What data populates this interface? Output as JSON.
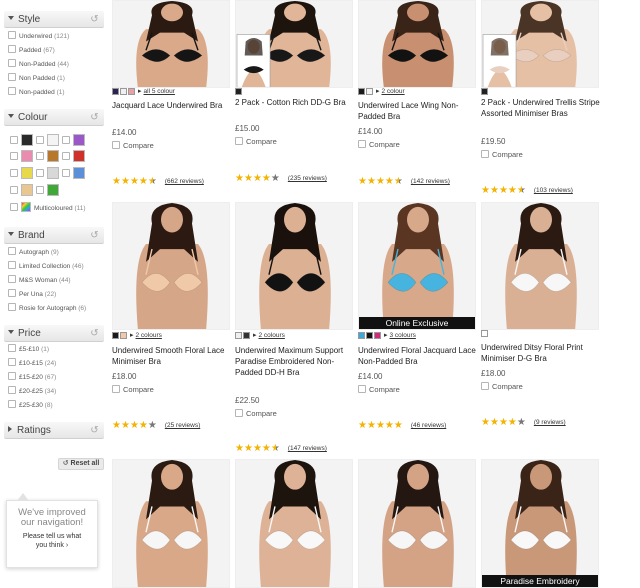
{
  "filters": {
    "style": {
      "title": "Style",
      "options": [
        {
          "label": "Underwired",
          "count": "(121)"
        },
        {
          "label": "Padded",
          "count": "(67)"
        },
        {
          "label": "Non-Padded",
          "count": "(44)"
        },
        {
          "label": "Non Padded",
          "count": "(1)"
        },
        {
          "label": "Non-padded",
          "count": "(1)"
        }
      ]
    },
    "colour": {
      "title": "Colour",
      "swatches": [
        "#2a2a2a",
        "#f4f4f4",
        "#9a58c8",
        "#e98cb0",
        "#b8782a",
        "#d0312b",
        "#e8d94a",
        "#d8d8d8",
        "#5b8fd8",
        "#e8c890",
        "#3fa838"
      ],
      "multicoloured": {
        "label": "Multicoloured",
        "count": "(11)"
      }
    },
    "brand": {
      "title": "Brand",
      "options": [
        {
          "label": "Autograph",
          "count": "(9)"
        },
        {
          "label": "Limited Collection",
          "count": "(46)"
        },
        {
          "label": "M&S Woman",
          "count": "(44)"
        },
        {
          "label": "Per Una",
          "count": "(22)"
        },
        {
          "label": "Rosie for Autograph",
          "count": "(6)"
        }
      ]
    },
    "price": {
      "title": "Price",
      "options": [
        {
          "label": "£5-£10",
          "count": "(1)"
        },
        {
          "label": "£10-£15",
          "count": "(24)"
        },
        {
          "label": "£15-£20",
          "count": "(67)"
        },
        {
          "label": "£20-£25",
          "count": "(34)"
        },
        {
          "label": "£25-£30",
          "count": "(8)"
        }
      ]
    },
    "ratings": {
      "title": "Ratings"
    },
    "reset_label": "Reset all"
  },
  "feedback": {
    "line1": "We've improved",
    "line2": "our navigation!",
    "line3": "Please tell us what",
    "line4": "you think",
    "arrow": "›"
  },
  "compare_label": "Compare",
  "products": [
    {
      "title": "Jacquard Lace Underwired Bra",
      "price": "£14.00",
      "rating": 4.5,
      "reviews": "(662 reviews)",
      "thumbs": [
        "#2a2250",
        "#f0f0f0",
        "#e8a0a8"
      ],
      "colours": "all 5 colour",
      "skin": "#d9a98a",
      "hair": "#2a1a12",
      "bra": "#151515",
      "inset": false,
      "banner": ""
    },
    {
      "title": "2 Pack - Cotton Rich DD-G Bra",
      "price": "£15.00",
      "rating": 4,
      "reviews": "(235 reviews)",
      "thumbs": [
        "#222222"
      ],
      "colours": "",
      "skin": "#e0b598",
      "hair": "#1e140e",
      "bra": "#181818",
      "inset": true,
      "banner": ""
    },
    {
      "title": "Underwired Lace Wing Non-Padded Bra",
      "price": "£14.00",
      "rating": 4.5,
      "reviews": "(142 reviews)",
      "thumbs": [
        "#1a1a1a",
        "#f5f5f5"
      ],
      "colours": "2 colour",
      "skin": "#c89070",
      "hair": "#3a2418",
      "bra": "#121212",
      "inset": false,
      "banner": ""
    },
    {
      "title": "2 Pack - Underwired Trellis Stripe Assorted Minimiser Bras",
      "price": "£19.50",
      "rating": 4.5,
      "reviews": "(103 reviews)",
      "thumbs": [
        "#222222"
      ],
      "colours": "",
      "skin": "#e6c0a4",
      "hair": "#4a3426",
      "bra": "#e8cfc0",
      "inset": true,
      "banner": ""
    },
    {
      "title": "Underwired Smooth Floral Lace Minimiser Bra",
      "price": "£18.00",
      "rating": 4,
      "reviews": "(25 reviews)",
      "thumbs": [
        "#1a1a1a",
        "#f3c8a8"
      ],
      "colours": "2 colours",
      "skin": "#d6a688",
      "hair": "#2c1a12",
      "bra": "#efc9a8",
      "inset": false,
      "banner": ""
    },
    {
      "title": "Underwired Maximum Support Paradise Embroidered Non-Padded DD-H Bra",
      "price": "£22.50",
      "rating": 4.5,
      "reviews": "(147 reviews)",
      "thumbs": [
        "#f0f0f0",
        "#333333"
      ],
      "colours": "2 colours",
      "skin": "#dcb093",
      "hair": "#1a110c",
      "bra": "#121212",
      "inset": false,
      "banner": ""
    },
    {
      "title": "Underwired Floral Jacquard Lace Non-Padded Bra",
      "price": "£14.00",
      "rating": 5,
      "reviews": "(46 reviews)",
      "thumbs": [
        "#3aa8d8",
        "#111111",
        "#d02a7a"
      ],
      "colours": "3 colours",
      "skin": "#d8a88a",
      "hair": "#5a3622",
      "bra": "#46b4de",
      "inset": false,
      "banner": "Online Exclusive"
    },
    {
      "title": "Underwired Ditsy Floral Print Minimiser D-G Bra",
      "price": "£18.00",
      "rating": 4,
      "reviews": "(9 reviews)",
      "thumbs": [
        "#ffffff"
      ],
      "colours": "",
      "skin": "#dab094",
      "hair": "#2a1a12",
      "bra": "#f7f7f7",
      "inset": false,
      "banner": ""
    },
    {
      "title": "",
      "price": "",
      "rating": 0,
      "reviews": "",
      "thumbs": [],
      "colours": "",
      "skin": "#d8a888",
      "hair": "#2a1a12",
      "bra": "#f6f6f6",
      "inset": false,
      "banner": ""
    },
    {
      "title": "",
      "price": "",
      "rating": 0,
      "reviews": "",
      "thumbs": [],
      "colours": "",
      "skin": "#deb296",
      "hair": "#1e140e",
      "bra": "#f8f8f8",
      "inset": false,
      "banner": ""
    },
    {
      "title": "",
      "price": "",
      "rating": 0,
      "reviews": "",
      "thumbs": [],
      "colours": "",
      "skin": "#d4a284",
      "hair": "#241610",
      "bra": "#f6f6f6",
      "inset": false,
      "banner": ""
    },
    {
      "title": "",
      "price": "",
      "rating": 0,
      "reviews": "",
      "thumbs": [],
      "colours": "",
      "skin": "#c99878",
      "hair": "#3a2418",
      "bra": "#f8f8f8",
      "inset": false,
      "banner": "Paradise Embroidery"
    }
  ]
}
